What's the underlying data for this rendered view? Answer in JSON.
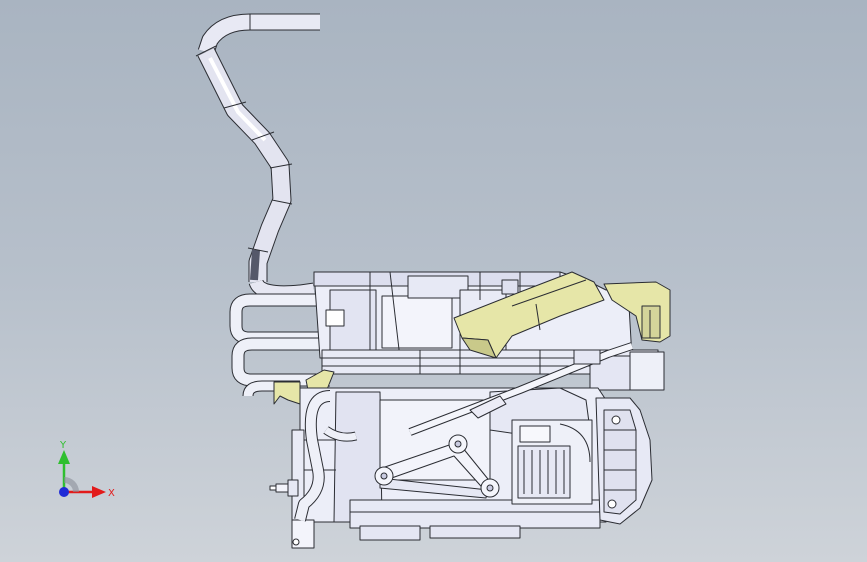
{
  "app": {
    "view": "cad-viewport"
  },
  "colors": {
    "background_top": "#a9b4c1",
    "background_bottom": "#ced3d9",
    "edge": "#2b2d33",
    "metal": "#eceef8",
    "metal_shade": "#c9cbe0",
    "yellow_part": "#e6e6a8",
    "yellow_shade": "#c9c98a",
    "axis_x": "#e21b1b",
    "axis_y": "#2fbf2f",
    "axis_z": "#1f2bd6"
  },
  "triad": {
    "x_label": "X",
    "y_label": "Y"
  }
}
